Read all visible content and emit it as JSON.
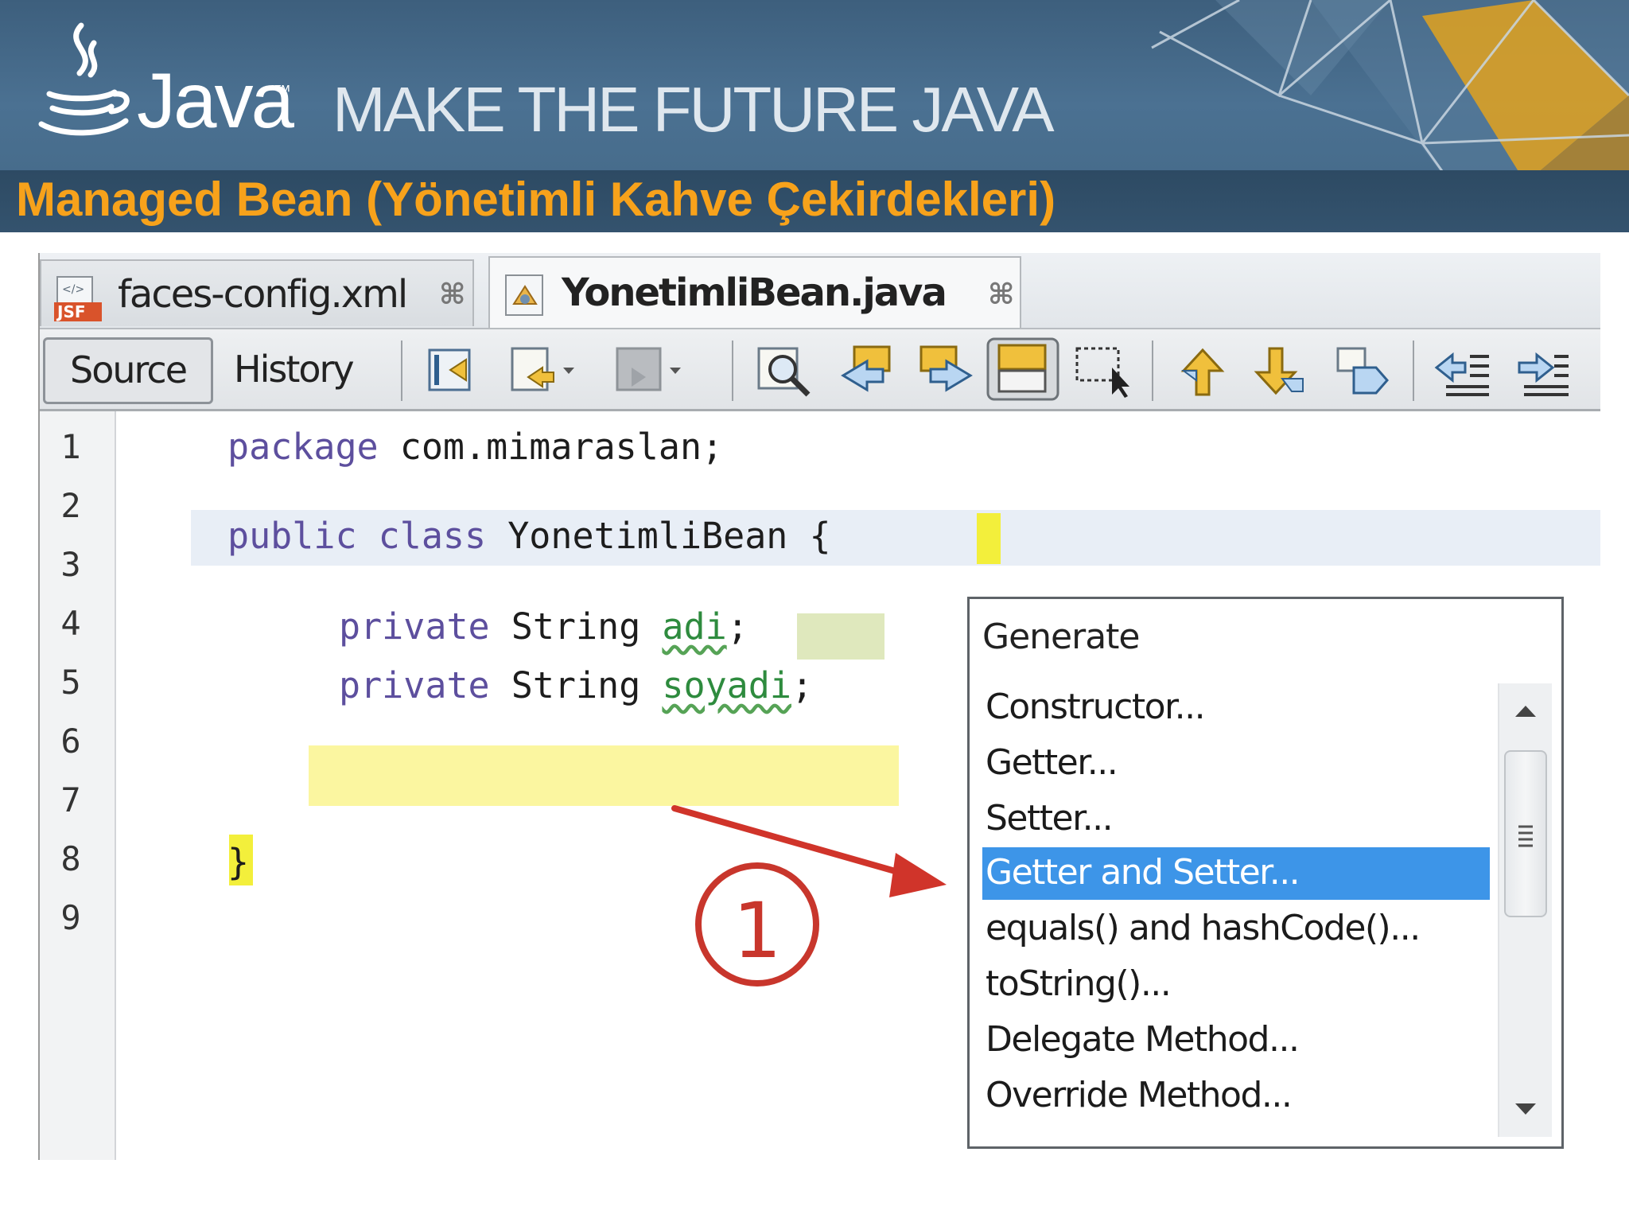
{
  "slide": {
    "brand": "Java",
    "tagline": "MAKE THE FUTURE JAVA",
    "title": "Managed Bean (Yönetimli Kahve Çekirdekleri)"
  },
  "colors": {
    "title": "#f7a21b",
    "header_bg": "#466b8b",
    "selection": "#3d95e8",
    "annotation": "#c8362c",
    "keyword": "#5d4f9e",
    "field": "#2e8b3e"
  },
  "tabs": [
    {
      "label": "faces-config.xml",
      "icon": "jsf-xml-file-icon",
      "close": "⌘",
      "active": false
    },
    {
      "label": "YonetimliBean.java",
      "icon": "java-class-file-icon",
      "close": "⌘",
      "active": true
    }
  ],
  "toolbar": {
    "source_label": "Source",
    "history_label": "History",
    "icons": [
      "last-edit-icon",
      "back-icon",
      "forward-icon",
      "find-icon",
      "find-previous-icon",
      "find-next-icon",
      "toggle-highlight-icon",
      "toggle-rectangular-selection-icon",
      "previous-bookmark-icon",
      "next-bookmark-icon",
      "toggle-bookmark-icon",
      "shift-left-icon",
      "shift-right-icon"
    ]
  },
  "editor": {
    "line_numbers": [
      "1",
      "2",
      "3",
      "4",
      "5",
      "6",
      "7",
      "8",
      "9"
    ],
    "code": {
      "line1_kw": "package",
      "line1_rest": " com.mimaraslan;",
      "line3_kw": "public class",
      "line3_name": " YonetimliBean ",
      "line3_brace": "{",
      "line4_kw": "private",
      "line4_type": " String ",
      "line4_field": "adi",
      "line4_end": ";",
      "line5_kw": "private",
      "line5_type": " String ",
      "line5_field": "soyadi",
      "line5_end": ";",
      "line8_brace": "}"
    }
  },
  "popup": {
    "title": "Generate",
    "items": [
      "Constructor...",
      "Getter...",
      "Setter...",
      "Getter and Setter...",
      "equals() and hashCode()...",
      "toString()...",
      "Delegate Method...",
      "Override Method..."
    ],
    "selected_index": 3
  },
  "annotation": {
    "number": "1"
  }
}
